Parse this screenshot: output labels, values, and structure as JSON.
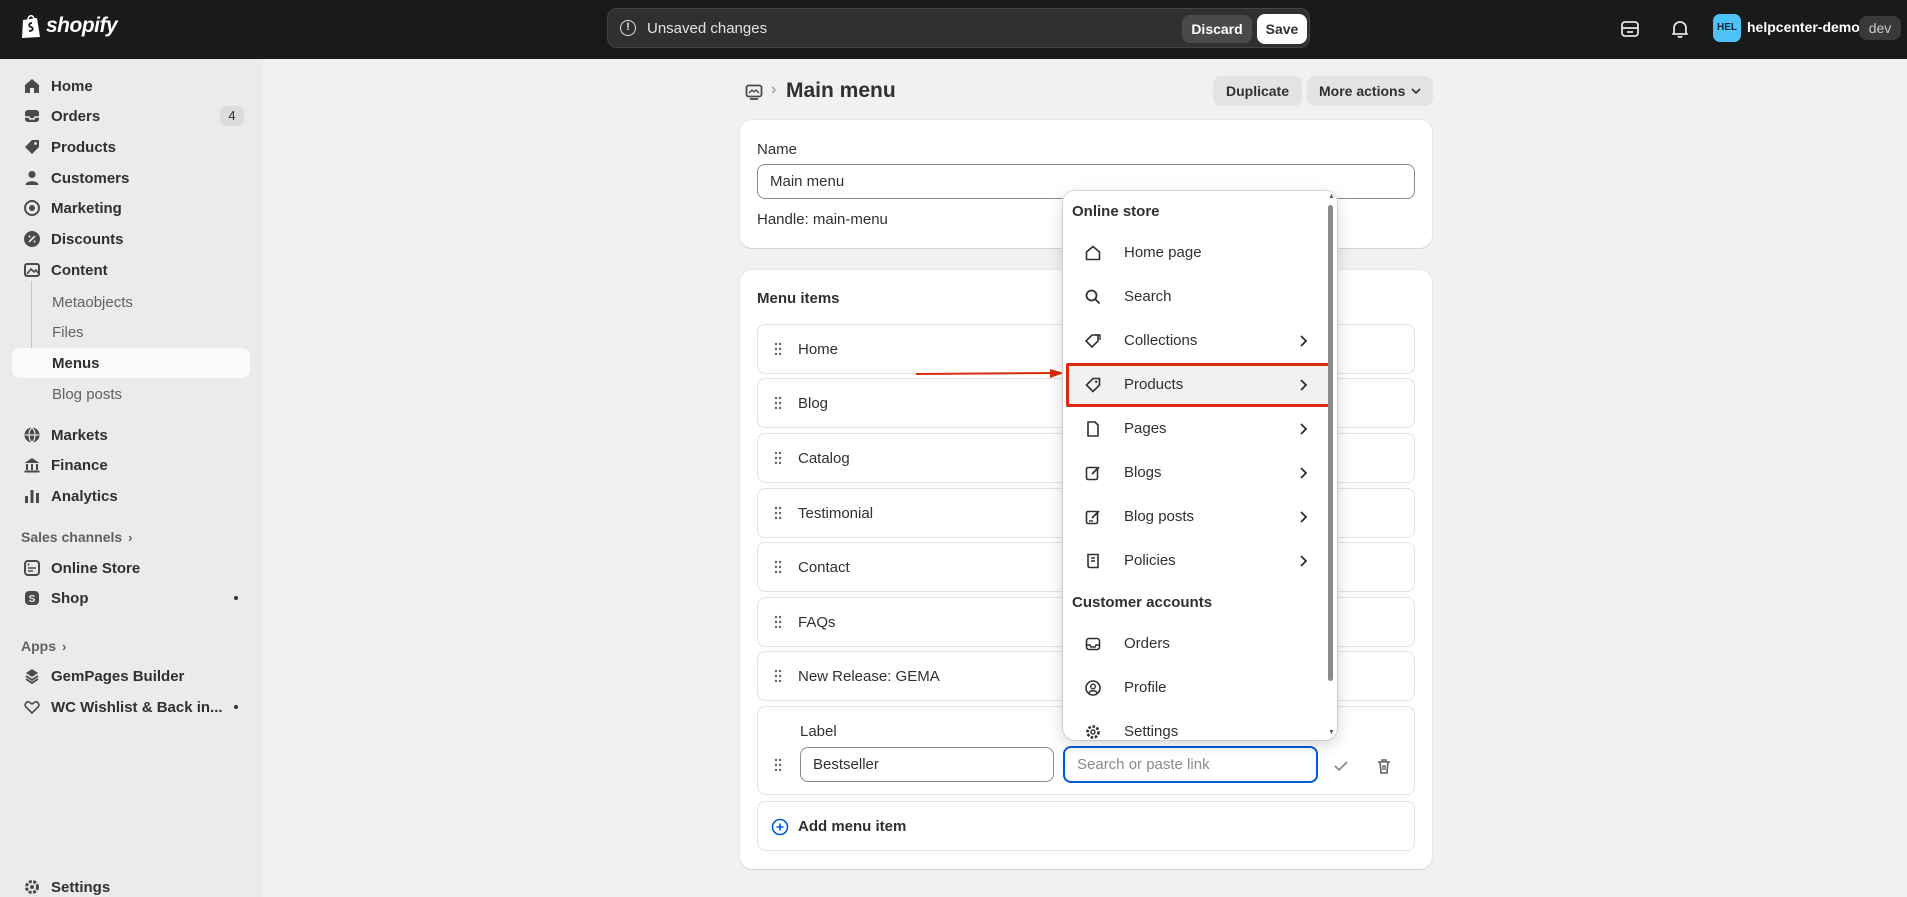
{
  "topbar": {
    "brand": "shopify",
    "unsaved_text": "Unsaved changes",
    "discard_label": "Discard",
    "save_label": "Save",
    "store_avatar": "HEL",
    "store_name": "helpcenter-demo",
    "store_badge": "dev"
  },
  "sidebar": {
    "items": [
      {
        "label": "Home",
        "icon": "home-icon"
      },
      {
        "label": "Orders",
        "icon": "inbox-icon",
        "badge": "4"
      },
      {
        "label": "Products",
        "icon": "tag-icon"
      },
      {
        "label": "Customers",
        "icon": "person-icon"
      },
      {
        "label": "Marketing",
        "icon": "target-icon"
      },
      {
        "label": "Discounts",
        "icon": "discount-icon"
      },
      {
        "label": "Content",
        "icon": "image-icon"
      }
    ],
    "content_sub": [
      {
        "label": "Metaobjects"
      },
      {
        "label": "Files"
      },
      {
        "label": "Menus"
      },
      {
        "label": "Blog posts"
      }
    ],
    "items2": [
      {
        "label": "Markets",
        "icon": "globe-icon"
      },
      {
        "label": "Finance",
        "icon": "bank-icon"
      },
      {
        "label": "Analytics",
        "icon": "bar-chart-icon"
      }
    ],
    "sales_channels_label": "Sales channels",
    "channels": [
      {
        "label": "Online Store",
        "icon": "store-icon"
      },
      {
        "label": "Shop",
        "icon": "shop-icon"
      }
    ],
    "apps_label": "Apps",
    "apps": [
      {
        "label": "GemPages Builder",
        "icon": "gempages-icon"
      },
      {
        "label": "WC Wishlist & Back in...",
        "icon": "wishlist-icon"
      }
    ],
    "settings_label": "Settings"
  },
  "page": {
    "title": "Main menu",
    "separator": "›",
    "duplicate_label": "Duplicate",
    "more_actions_label": "More actions"
  },
  "name_card": {
    "name_label": "Name",
    "name_value": "Main menu",
    "handle_text": "Handle: main-menu"
  },
  "menu_card": {
    "title": "Menu items",
    "items": [
      "Home",
      "Blog",
      "Catalog",
      "Testimonial",
      "Contact",
      "FAQs",
      "New Release: GEMA"
    ],
    "edit_label": "Label",
    "edit_label_value": "Bestseller",
    "link_placeholder": "Search or paste link",
    "add_label": "Add menu item"
  },
  "dropdown": {
    "section1": "Online store",
    "online_store_items": [
      {
        "label": "Home page",
        "icon": "home-icon",
        "chevron": false
      },
      {
        "label": "Search",
        "icon": "search-icon",
        "chevron": false
      },
      {
        "label": "Collections",
        "icon": "collections-icon",
        "chevron": true
      },
      {
        "label": "Products",
        "icon": "tag-icon",
        "chevron": true
      },
      {
        "label": "Pages",
        "icon": "page-icon",
        "chevron": true
      },
      {
        "label": "Blogs",
        "icon": "blog-icon",
        "chevron": true
      },
      {
        "label": "Blog posts",
        "icon": "blog-post-icon",
        "chevron": true
      },
      {
        "label": "Policies",
        "icon": "policy-icon",
        "chevron": true
      }
    ],
    "section2": "Customer accounts",
    "customer_items": [
      {
        "label": "Orders",
        "icon": "inbox-icon"
      },
      {
        "label": "Profile",
        "icon": "profile-icon"
      },
      {
        "label": "Settings",
        "icon": "gear-icon"
      }
    ],
    "highlight_color": "#d82c0d"
  },
  "colors": {
    "topbar": "#1a1a1a",
    "background": "#f1f1f1",
    "focus_ring": "#005bd3",
    "annotation_red": "#d82c0d"
  }
}
